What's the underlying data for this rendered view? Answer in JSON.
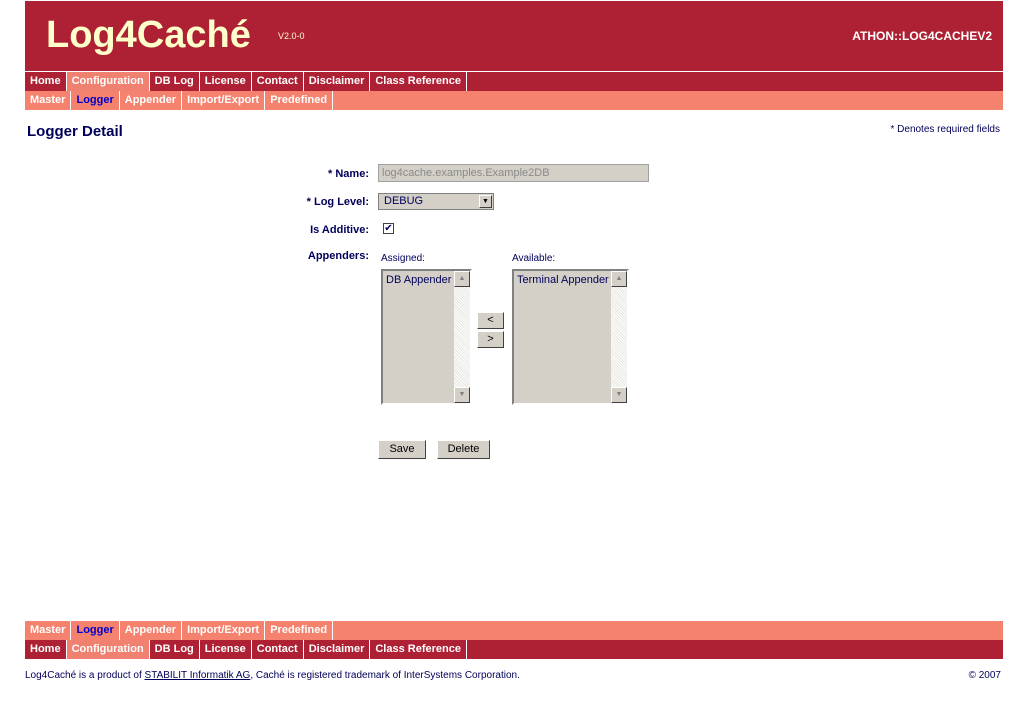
{
  "header": {
    "logo": "Log4Caché",
    "version": "V2.0-0",
    "namespace": "ATHON::LOG4CACHEV2"
  },
  "main_nav": [
    {
      "label": "Home",
      "active": false
    },
    {
      "label": "Configuration",
      "active": true
    },
    {
      "label": "DB Log",
      "active": false
    },
    {
      "label": "License",
      "active": false
    },
    {
      "label": "Contact",
      "active": false
    },
    {
      "label": "Disclaimer",
      "active": false
    },
    {
      "label": "Class Reference",
      "active": false
    }
  ],
  "sub_nav": [
    {
      "label": "Master",
      "active": false
    },
    {
      "label": "Logger",
      "active": true
    },
    {
      "label": "Appender",
      "active": false
    },
    {
      "label": "Import/Export",
      "active": false
    },
    {
      "label": "Predefined",
      "active": false
    }
  ],
  "page": {
    "title": "Logger Detail",
    "required_note": "* Denotes required fields"
  },
  "form": {
    "name_label": "* Name:",
    "name_value": "log4cache.examples.Example2DB",
    "log_level_label": "* Log Level:",
    "log_level_value": "DEBUG",
    "is_additive_label": "Is Additive:",
    "is_additive_checked": true,
    "appenders_label": "Appenders:",
    "assigned_label": "Assigned:",
    "available_label": "Available:",
    "assigned_items": [
      "DB Appender"
    ],
    "available_items": [
      "Terminal Appender"
    ],
    "move_left_label": "<",
    "move_right_label": ">",
    "save_label": "Save",
    "delete_label": "Delete"
  },
  "footer": {
    "prefix": "Log4Caché is a product of ",
    "company_link": "STABILIT Informatik AG",
    "suffix": ", Caché is registered trademark of InterSystems Corporation.",
    "copyright": "© 2007"
  },
  "colors": {
    "brand_red": "#ae2134",
    "salmon": "#f4826e",
    "text_navy": "#00005a",
    "logo_cream": "#ffffcc"
  }
}
